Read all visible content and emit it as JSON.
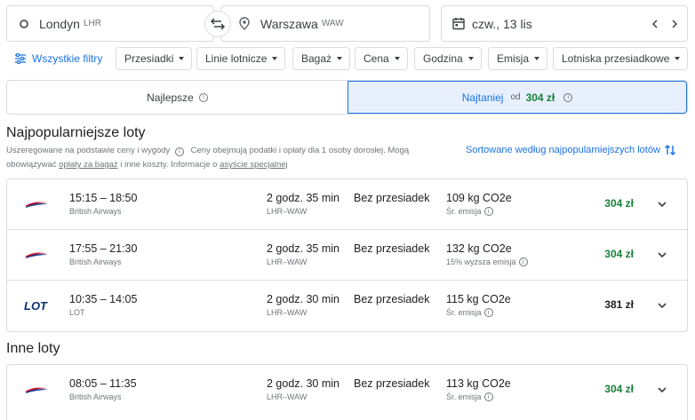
{
  "search": {
    "origin": {
      "city": "Londyn",
      "code": "LHR"
    },
    "destination": {
      "city": "Warszawa",
      "code": "WAW"
    },
    "date": "czw., 13 lis"
  },
  "filters": {
    "all_label": "Wszystkie filtry",
    "chips": [
      "Przesiadki",
      "Linie lotnicze",
      "Bagaż",
      "Cena",
      "Godzina",
      "Emisja",
      "Lotniska przesiadkowe"
    ]
  },
  "tabs": {
    "best": "Najlepsze",
    "cheapest": "Najtaniej",
    "cheapest_from": "od",
    "cheapest_price": "304 zł"
  },
  "popular": {
    "title": "Najpopularniejsze loty",
    "subtitle_part1": "Uszeregowane na podstawie ceny i wygody",
    "subtitle_part2": "Ceny obejmują podatki i opłaty dla 1 osoby dorosłej. Mogą obowiązywać",
    "bag_fees_link": "opłaty za bagaż",
    "subtitle_part3": "i inne koszty. Informacje o",
    "special_assistance_link": "asyście specjalnej",
    "sort_label": "Sortowane według najpopularniejszych lotów"
  },
  "other": {
    "title": "Inne loty"
  },
  "flights_popular": [
    {
      "logo": "british-airways",
      "times": "15:15 – 18:50",
      "airline": "British Airways",
      "duration": "2 godz. 35 min",
      "route": "LHR–WAW",
      "stops": "Bez przesiadek",
      "co2": "109 kg CO2e",
      "emission": "Śr. emisja",
      "price": "304 zł",
      "price_color": "#188038"
    },
    {
      "logo": "british-airways",
      "times": "17:55 – 21:30",
      "airline": "British Airways",
      "duration": "2 godz. 35 min",
      "route": "LHR–WAW",
      "stops": "Bez przesiadek",
      "co2": "132 kg CO2e",
      "emission": "15% wyższa emisja",
      "price": "304 zł",
      "price_color": "#188038"
    },
    {
      "logo": "lot",
      "times": "10:35 – 14:05",
      "airline": "LOT",
      "duration": "2 godz. 30 min",
      "route": "LHR–WAW",
      "stops": "Bez przesiadek",
      "co2": "115 kg CO2e",
      "emission": "Śr. emisja",
      "price": "381 zł",
      "price_color": "#202124"
    }
  ],
  "flights_other": [
    {
      "logo": "british-airways",
      "times": "08:05 – 11:35",
      "airline": "British Airways",
      "duration": "2 godz. 30 min",
      "route": "LHR–WAW",
      "stops": "Bez przesiadek",
      "co2": "113 kg CO2e",
      "emission": "Śr. emisja",
      "price": "304 zł",
      "price_color": "#188038"
    }
  ],
  "colors": {
    "accent": "#1a73e8",
    "price_green": "#188038",
    "border": "#dadce0",
    "tab_selected_bg": "#e8f0fe"
  }
}
